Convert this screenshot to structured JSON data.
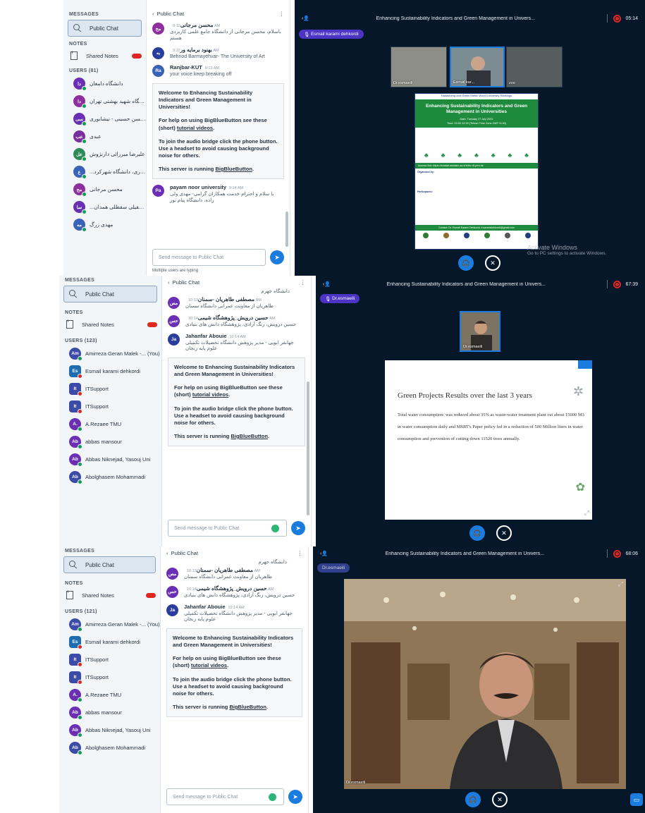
{
  "common": {
    "messages_header": "MESSAGES",
    "public_chat": "Public Chat",
    "notes_header": "NOTES",
    "shared_notes": "Shared Notes",
    "chat_title": "Public Chat",
    "send_placeholder": "Send message to Public Chat",
    "welcome": {
      "title": "Welcome to Enhancing Sustainability Indicators and Green Management in Universities!",
      "help_prefix": "For help on using BigBlueButton see these (short) ",
      "help_link": "tutorial videos",
      "help_suffix": ".",
      "audio": "To join the audio bridge click the phone button. Use a headset to avoid causing background noise for others.",
      "running_prefix": "This server is running ",
      "running_link": "BigBlueButton",
      "running_suffix": "."
    },
    "presentation_title": "Enhancing Sustainability Indicators and Green Management in Univers...",
    "activate_windows": "Activate Windows",
    "activate_windows_sub": "Go to PC settings to activate Windows.",
    "colors": {
      "accent": "#1b7cdf",
      "talker": "#4c35c4",
      "record": "#df2721",
      "presentation_bg": "#06172a"
    }
  },
  "panel1": {
    "users_header": "USERS (81)",
    "users": [
      {
        "initials": "دا",
        "name": "دانشگاه دامغان",
        "color": "#6a2fb3"
      },
      {
        "initials": "دا",
        "name": "دانشگاه شهید بهشتی تهران",
        "color": "#8d2f9c"
      },
      {
        "initials": "سی",
        "name": "سید محسن حسینی - نیشابوری",
        "color": "#6a2fb3"
      },
      {
        "initials": "عب",
        "name": "عبدی",
        "color": "#7b2f9c"
      },
      {
        "initials": "عل",
        "name": "علیرضا میرزائی دارنژوش",
        "color": "#2e8b57"
      },
      {
        "initials": "ع",
        "name": "...ی ادارى، دانشگاه شهركرد",
        "color": "#3a62b7"
      },
      {
        "initials": "مح",
        "name": "محسن مرجانی",
        "color": "#8d2f9c"
      },
      {
        "initials": "سا",
        "name": "...سا عقیلی سقطلی همدان",
        "color": "#6a2fb3"
      },
      {
        "initials": "مه",
        "name": "مهدی زرگ",
        "color": "#3a62b7"
      }
    ],
    "messages": [
      {
        "initials": "مح",
        "name": "محسن مرجانی",
        "time": "9:12 AM",
        "text": "باسلام، محسن مرجانی از دانشگاه جامع علمی کاربردی هستم",
        "color": "#8d2f9c"
      },
      {
        "initials": "به",
        "name": "بهنود برمایه ور",
        "time": "9:12 AM",
        "text": "Behnod Barmayehvar- The University of Art",
        "color": "#2a3d9c"
      },
      {
        "initials": "Ra",
        "name": "Ranjbar-KUT",
        "time": "9:13 AM",
        "text": "your voice keep breaking off",
        "color": "#3a62b7"
      }
    ],
    "after_message": {
      "initials": "Pa",
      "name": "payam noor university",
      "time": "9:14 AM",
      "text": "با سلام و احترام خدمت همکاران گرامی- مهدی ولی زاده، دانشگاه پیام نور",
      "color": "#6a2fb3"
    },
    "typing": "Multiple users are typing",
    "talker": "Esmail karami dehkordi",
    "timer": "05:14",
    "cams": [
      "Dr.esmaeili",
      "Esmail kar...",
      "zoo"
    ],
    "slide": {
      "header": "Hadasheng and Green Metric World University Rankings",
      "title": "Enhancing Sustainability Indicators and Green Management in Universities",
      "date": "Date: Tuesday 27 July 2021",
      "time": "Time: 09:00-12:30 (Tehran Time Zone GMT+4:30)",
      "access": "Access link: https://edufair.medairc.ac.ir/b/thr-r5-peo-kk",
      "organized_by": "Organized by:",
      "participants": "Participants:",
      "contact": "Contact: Dr. Esmail Karami Dehkordi, e.karamidehkordi@gmail.com"
    }
  },
  "panel2": {
    "users_header": "USERS (123)",
    "users": [
      {
        "initials": "Am",
        "name": "Amirreza Geran Malek -... (You)",
        "color": "#3b4ba6",
        "status": "g",
        "square": false
      },
      {
        "initials": "Es",
        "name": "Esmail karami dehkordi",
        "color": "#1f6fb0",
        "status": "r",
        "square": true
      },
      {
        "initials": "It",
        "name": "ITSupport",
        "color": "#3b4ba6",
        "status": "r",
        "square": true
      },
      {
        "initials": "It",
        "name": "ITSupport",
        "color": "#3b4ba6",
        "status": "r",
        "square": true
      },
      {
        "initials": "A.",
        "name": "A.Rezaee TMU",
        "color": "#6a2fb3",
        "status": "g",
        "square": false
      },
      {
        "initials": "Ab",
        "name": "abbas mansour",
        "color": "#6a2fb3",
        "status": "g",
        "square": false
      },
      {
        "initials": "Ab",
        "name": "Abbas Niknejad, Yasouj Uni",
        "color": "#6a2fb3",
        "status": "g",
        "square": false
      },
      {
        "initials": "Ab",
        "name": "Abolghasem Mohammadi",
        "color": "#3b4ba6",
        "status": "g",
        "square": false
      }
    ],
    "top_line": "دانشگاه جهرم",
    "messages": [
      {
        "initials": "مص",
        "name": "مصطفی طاهریان -سمنان",
        "time": "10:13 AM",
        "text": "طاهریان از معاونت عمرانی دانشگاه سمنان",
        "color": "#6a2fb3"
      },
      {
        "initials": "حس",
        "name": "حسین درویش_پژوهشگاه شیمی",
        "time": "10:14 AM",
        "text": "حسین درویش، رنگ آزادی، پژوهشگاه دانش های بنیادی",
        "color": "#6a2fb3"
      },
      {
        "initials": "Ja",
        "name": "Jahanfar Abouie",
        "time": "10:14 AM",
        "text": "جهانفر ابویی - مدیر پژوهش دانشگاه تحصیلات تکمیلی علوم پایه زنجان",
        "color": "#2a3d9c"
      }
    ],
    "talker": "Dr.esmaeili",
    "timer": "67:39",
    "cam_label": "Dr.esmaeili",
    "slide": {
      "title": "Green Projects Results over the last 3 years",
      "body": "Total water consumption: was reduced about 35% as waste-water treatment plant cut about 15000 M3 in water consumption daily and MSRT's Paper policy led in a reduction of 500 Million liters in water consumption and prevention of cutting down 11520 trees annually."
    }
  },
  "panel3": {
    "users_header": "USERS (121)",
    "users": [
      {
        "initials": "Am",
        "name": "Amirreza Geran Malek -... (You)",
        "color": "#3b4ba6",
        "status": "g",
        "square": false
      },
      {
        "initials": "Es",
        "name": "Esmail karami dehkordi",
        "color": "#1f6fb0",
        "status": "r",
        "square": true
      },
      {
        "initials": "It",
        "name": "ITSupport",
        "color": "#3b4ba6",
        "status": "r",
        "square": true
      },
      {
        "initials": "It",
        "name": "ITSupport",
        "color": "#3b4ba6",
        "status": "r",
        "square": true
      },
      {
        "initials": "A.",
        "name": "A.Rezaee TMU",
        "color": "#6a2fb3",
        "status": "g",
        "square": false
      },
      {
        "initials": "Ab",
        "name": "abbas mansour",
        "color": "#6a2fb3",
        "status": "g",
        "square": false
      },
      {
        "initials": "Ab",
        "name": "Abbas Niknejad, Yasouj Uni",
        "color": "#6a2fb3",
        "status": "g",
        "square": false
      },
      {
        "initials": "Ab",
        "name": "Abolghasem Mohammadi",
        "color": "#3b4ba6",
        "status": "g",
        "square": false
      }
    ],
    "top_line": "دانشگاه جهرم",
    "messages": [
      {
        "initials": "مص",
        "name": "مصطفی طاهریان -سمنان",
        "time": "10:13 AM",
        "text": "طاهریان از معاونت عمرانی دانشگاه سمنان",
        "color": "#6a2fb3"
      },
      {
        "initials": "حس",
        "name": "حسین درویش_پژوهشگاه شیمی",
        "time": "10:14 AM",
        "text": "حسین درویش، رنگ آزادی، پژوهشگاه دانش های بنیادی",
        "color": "#6a2fb3"
      },
      {
        "initials": "Ja",
        "name": "Jahanfar Abouie",
        "time": "10:14 AM",
        "text": "جهانفر ابویی - مدیر پژوهش دانشگاه تحصیلات تکمیلی علوم پایه زنجان",
        "color": "#2a3d9c"
      }
    ],
    "talker": "Dr.esmaeili",
    "timer": "68:06",
    "cam_label": "Dr.esmaeili"
  }
}
